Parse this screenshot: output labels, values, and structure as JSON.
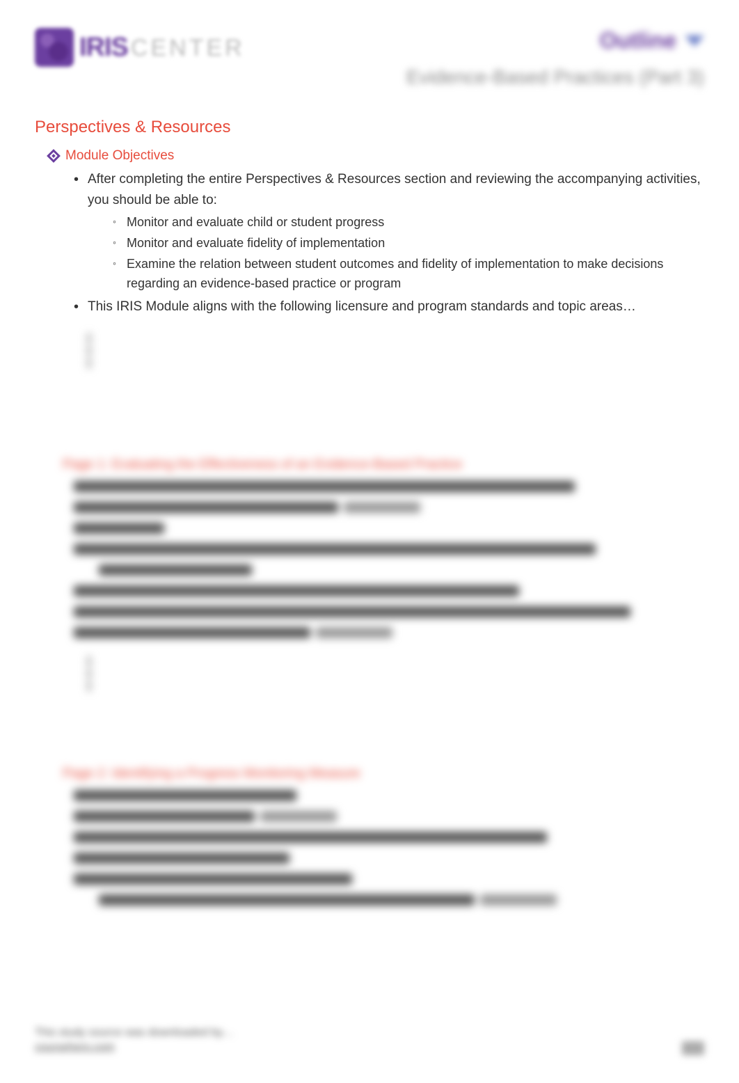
{
  "header": {
    "logo_iris": "IRIS",
    "logo_center": "CENTER",
    "outline_label": "Outline",
    "subtitle": "Evidence-Based Practices (Part 3)"
  },
  "section1": {
    "title": "Perspectives & Resources",
    "module_title": "Module Objectives",
    "intro": "After completing the entire Perspectives & Resources section and reviewing the accompanying activities, you should be able to:",
    "objectives": [
      "Monitor and evaluate child or student progress",
      "Monitor and evaluate fidelity of implementation",
      "Examine the relation between student outcomes and fidelity of implementation to make decisions regarding an evidence-based practice or program"
    ],
    "alignment": "This IRIS Module aligns with the following licensure and program standards and topic areas…"
  },
  "section2": {
    "title": "Page 1: Evaluating the Effectiveness of an Evidence-Based Practice",
    "lines": [
      "Implementing an evidence-based practice or program (EBP) increases the likelihood that…",
      "To judge a program's effectiveness, you should… (bullet points)",
      "If fidelity is high…",
      "Audio: Bryan Cook discusses the importance of collecting both progress monitoring data and implementation fidelity data",
      "Audio: Bryan Cook explains why an EBP might not be effective for all students",
      "Audio: Lisa talks with more thoughts as to why an EBP might not be effective for all students",
      "In this module's sections, you will learn how to… (bullet points)"
    ]
  },
  "section3": {
    "title": "Page 2: Identifying a Progress Monitoring Measure",
    "lines": [
      "EBP: progress monitoring (definition)",
      "General outcome measure (e.g.,… (bullet points))",
      "Audio: Tom Kratochwill identifies two reasons why progress monitoring is important",
      "The first step in progress monitoring is to…",
      "Select and Identify Progress Monitoring Measures",
      "FPG measures are available for the following developmental areas… (bullet points)"
    ]
  },
  "footer": {
    "source": "This study source was downloaded by…",
    "link": "coursehero.com"
  }
}
